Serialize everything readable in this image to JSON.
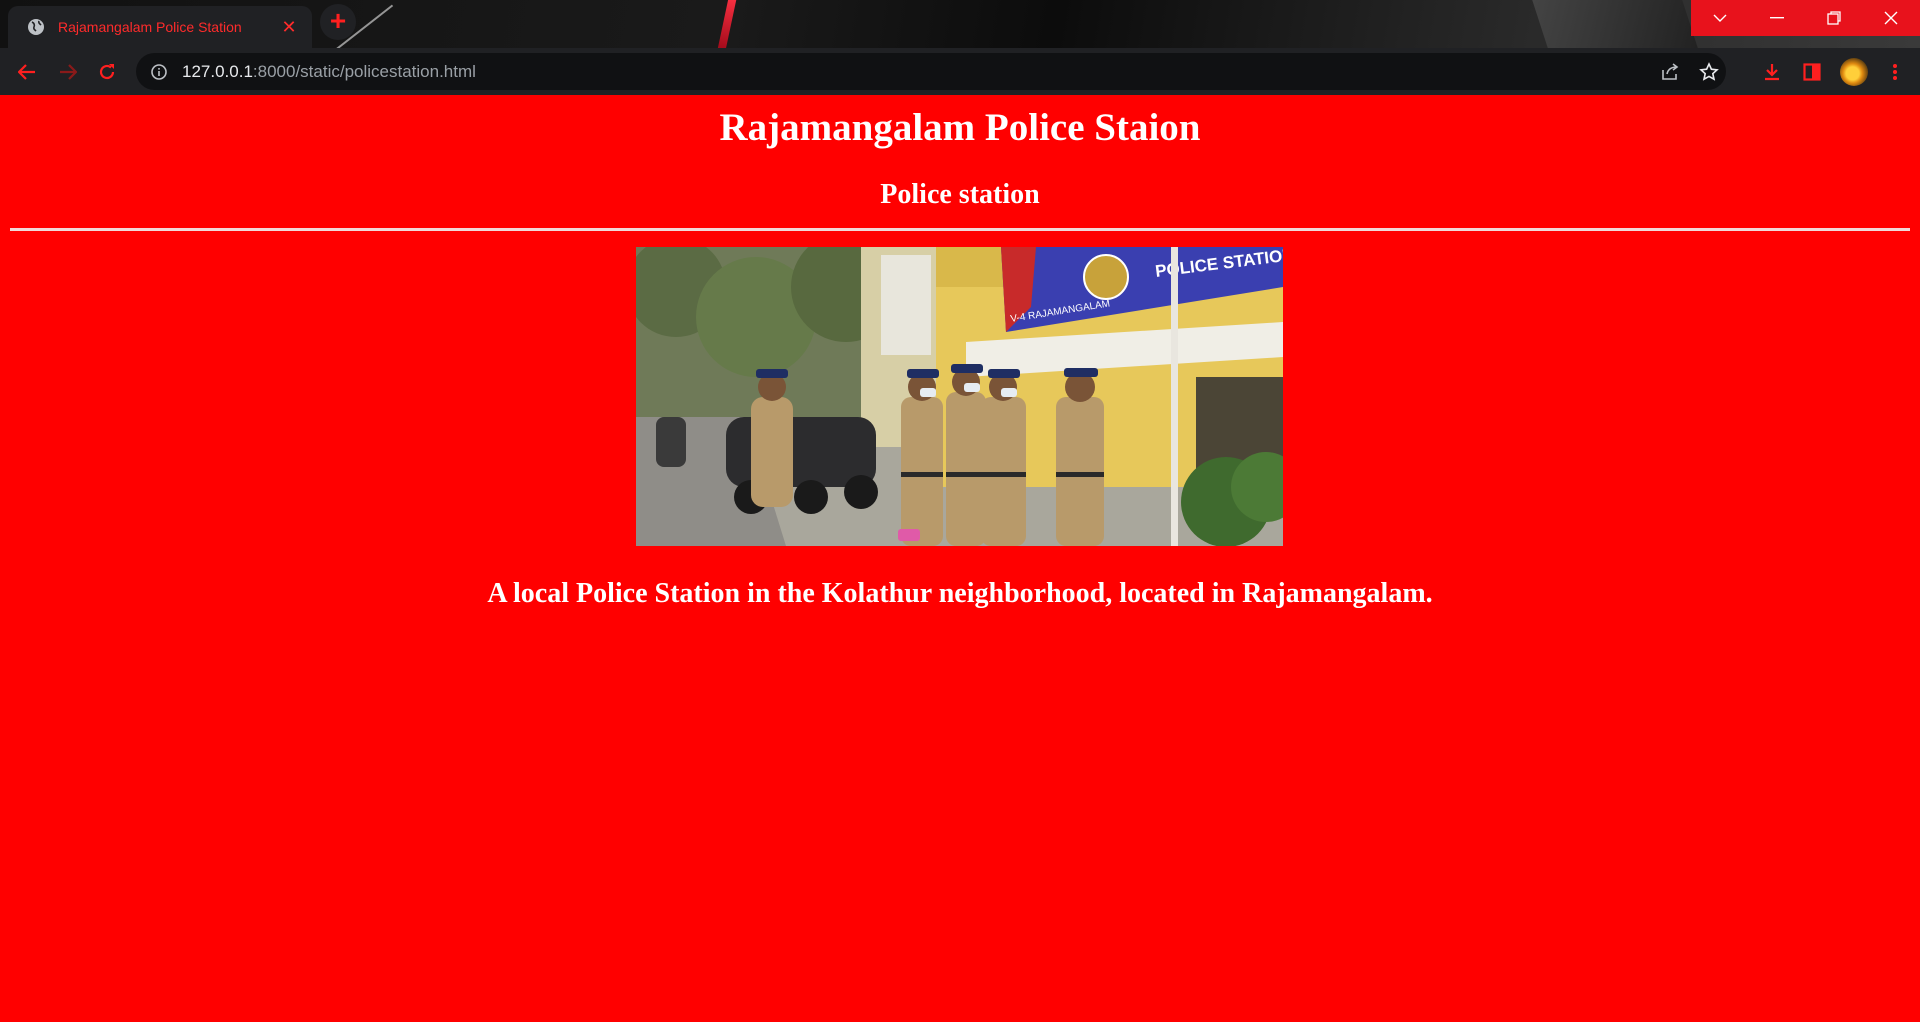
{
  "browser": {
    "tab": {
      "title": "Rajamangalam Police Station",
      "favicon": "globe-icon",
      "close_icon": "close-icon"
    },
    "new_tab_icon": "plus-icon",
    "window_controls": [
      "chevron-down-icon",
      "minimize-icon",
      "restore-icon",
      "close-icon"
    ],
    "nav": [
      "back-icon",
      "forward-icon",
      "reload-icon"
    ],
    "address": {
      "host": "127.0.0.1",
      "rest": ":8000/static/policestation.html"
    },
    "toolbar_icons": [
      "share-icon",
      "bookmark-star-icon",
      "download-icon",
      "side-panel-icon",
      "avatar",
      "menu-dots-icon"
    ],
    "accent_color": "#ff1f1f"
  },
  "page": {
    "title": "Rajamangalam Police Staion",
    "subtitle": "Police station",
    "image": {
      "subject": "police officers standing in front of a police station"
    },
    "description": "A local Police Station in the Kolathur neighborhood, located in Rajamangalam.",
    "background_color": "#ff0000",
    "text_color": "#ffffff"
  }
}
